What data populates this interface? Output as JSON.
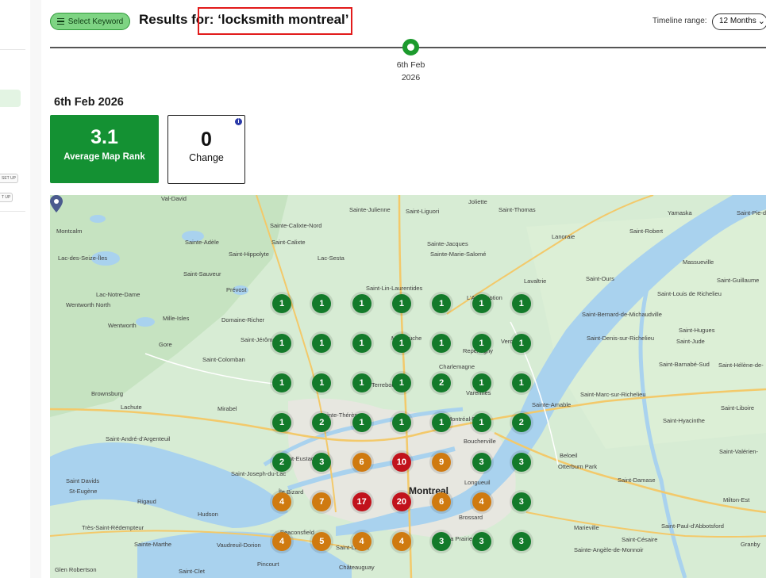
{
  "sidebar": {
    "chips": [
      "SET UP",
      "T UP"
    ]
  },
  "header": {
    "select_keyword_label": "Select Keyword",
    "results_prefix": "Results for: ",
    "query": "‘locksmith montreal’",
    "timeline_range_label": "Timeline range:",
    "timeline_range_value": "12 Months"
  },
  "timeline": {
    "points": [
      {
        "date_line1": "6th Feb",
        "date_line2": "2026"
      }
    ]
  },
  "summary": {
    "date": "6th Feb 2026",
    "average_map_rank": {
      "value": "3.1",
      "label": "Average Map Rank"
    },
    "change": {
      "value": "0",
      "label": "Change"
    }
  },
  "colors": {
    "good": "#137a2a",
    "mid": "#cf7a10",
    "bad": "#c1121c",
    "accent": "#149133"
  },
  "rank_grid": [
    [
      1,
      1,
      1,
      1,
      1,
      1,
      1
    ],
    [
      1,
      1,
      1,
      1,
      1,
      1,
      1
    ],
    [
      1,
      1,
      1,
      1,
      2,
      1,
      1
    ],
    [
      1,
      2,
      1,
      1,
      1,
      1,
      2
    ],
    [
      2,
      3,
      6,
      10,
      9,
      3,
      3
    ],
    [
      4,
      7,
      17,
      20,
      6,
      4,
      3
    ],
    [
      4,
      5,
      4,
      4,
      3,
      3,
      3
    ]
  ],
  "map_labels": [
    "Val-David",
    "Sainte-Julienne",
    "Saint-Liguori",
    "Joliette",
    "Saint-Thomas",
    "Yamaska",
    "Saint-Pie-de-Guire",
    "Montcalm",
    "Sainte-Calixte-Nord",
    "Saint-Calixte",
    "Sainte-Jacques",
    "Sainte-Marie-Salomé",
    "Lanoraie",
    "Saint-Robert",
    "Sainte-Adèle",
    "Saint-Hippolyte",
    "Lac-Sesta",
    "Massueville",
    "Lac-des-Seize-Îles",
    "Saint-Sauveur",
    "Saint-Lin-Laurentides",
    "Lavaltrie",
    "Saint-Ours",
    "Saint-Guillaume",
    "Lac-Notre-Dame",
    "Prévost",
    "L'Assomption",
    "Saint-Louis de Richelieu",
    "Wentworth North",
    "Mille-Isles",
    "Domaine-Richer",
    "Saint-Bernard-de-Michaudville",
    "Wentworth",
    "Saint-Jérôme",
    "Mascouche",
    "Saint-Denis-sur-Richelieu",
    "Saint-Hugues",
    "Gore",
    "Repentigny",
    "Verchères",
    "Saint-Jude",
    "Saint-Colomban",
    "Charlemagne",
    "Saint-Barnabé-Sud",
    "Saint-Hélène-de-",
    "Terrebonne",
    "Varennes",
    "Saint-Marc-sur-Richelieu",
    "Brownsburg",
    "Lachute",
    "Mirabel",
    "Sainte-Amable",
    "Saint-Liboire",
    "Sainte-Thérèse",
    "Montréal-Est",
    "Saint-Hyacinthe",
    "Saint-André-d'Argenteuil",
    "Boucherville",
    "Saint-Valérien-",
    "Saint-Eustache",
    "Beloeil",
    "Saint-Joseph-du-Lac",
    "Longueuil",
    "Otterburn Park",
    "Saint Davids",
    "St-Eugène",
    "Île Bizard",
    "Montreal",
    "Saint-Damase",
    "Rigaud",
    "Milton-Est",
    "Hudson",
    "Brossard",
    "Très-Saint-Rédempteur",
    "Beaconsfield",
    "Marieville",
    "Saint-Paul-d'Abbotsford",
    "Sainte-Marthe",
    "Vaudreuil-Dorion",
    "La Prairie",
    "Saint-Césaire",
    "Granby",
    "Saint-Lazare",
    "Sainte-Angèle-de-Monnoir",
    "Glen Robertson",
    "Saint-Clet",
    "Pincourt",
    "Châteauguay"
  ]
}
